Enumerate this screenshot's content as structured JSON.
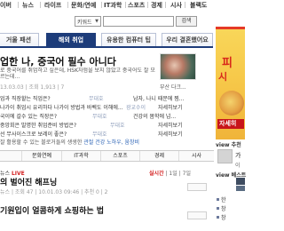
{
  "nav": {
    "items": [
      "이버 ",
      "뉴스",
      "라이프",
      "문화/연예",
      "IT과학",
      "스포츠",
      "경제",
      "시사",
      "블랙도"
    ]
  },
  "search": {
    "category": "키워드",
    "button": "검색",
    "value": ""
  },
  "tabs": [
    {
      "label": "거울 패션",
      "active": false
    },
    {
      "label": "해외 취업",
      "active": true
    },
    {
      "label": "유용한 컴퓨터 팁",
      "active": false
    },
    {
      "label": "우리 결혼했어요",
      "active": false
    }
  ],
  "featured": {
    "headline": "업한 나, 중국어 필수 아니다",
    "summary": "로 중국어를 취업하고 싶은데, HSK자험을 보지 않았고 중국어도 잘 모르는데...",
    "meta": "13.03.03 | 조회 1,913 | 7",
    "thumb_caption": "부산 다크..."
  },
  "articles": [
    {
      "title": "업과 직장할는 직업은?",
      "category": "무대호",
      "right": "남자, 나니 때문에 찜..."
    },
    {
      "title": "나가이 취업시 유리하다 나가이 방법과 바벡도 이해에...",
      "category": "광교수이",
      "right": "자세히보기"
    },
    {
      "title": "국이에 갈수 있는 직장은?",
      "category": "무대호",
      "right": "건강의 몸학에 넘..."
    },
    {
      "title": "중앙회은 발명한 취업준비 방법은?",
      "category": "무대호",
      "right": "자세히보기"
    },
    {
      "title": "선 무사이스크로 보레이 좋은?",
      "category": "무대호",
      "right": "자세히보기"
    }
  ],
  "banner": {
    "prefix": "잘 활용할 수 있는 블로거들의 생생한 ",
    "highlight": "관절 건강 노하우, 움창비",
    "suffix": ""
  },
  "section_tabs": [
    "",
    "문화연예",
    "IT과학",
    "스포츠",
    "경제",
    "시사"
  ],
  "live": {
    "badge": "LIVE",
    "label": "뉴스",
    "sort": [
      "실시간",
      "1일",
      "7일"
    ],
    "active_sort": "실시간",
    "title1": "의 벌어진 해프닝",
    "meta": "뉴스 | 조회 47 | 10.01.03 09:46 | 추천 0 | 2",
    "title2": "기원입이 얼콤하게 쇼핑하는 법"
  },
  "ad": {
    "line1": "피",
    "line2": "시",
    "cta": "자세히"
  },
  "sidebar": {
    "view_best": "view 추천",
    "best_text": "가",
    "best_sub": "이",
    "view_best2": "view 베스트",
    "items": [
      "한",
      "창",
      "창"
    ]
  },
  "colors": {
    "brand": "#1d3c7a",
    "live_red": "#d32020",
    "link_blue": "#2a62b5"
  }
}
